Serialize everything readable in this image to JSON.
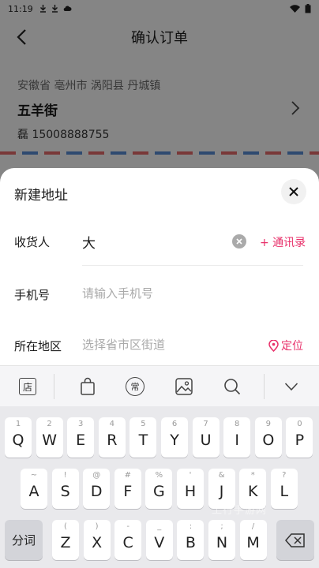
{
  "status_bar": {
    "time": "11:19"
  },
  "header": {
    "title": "确认订单"
  },
  "address": {
    "region": "安徽省 亳州市 涡阳县 丹城镇",
    "street": "五羊街",
    "contact": "磊 15008888755"
  },
  "sheet": {
    "title": "新建地址",
    "receiver": {
      "label": "收货人",
      "value": "大",
      "contacts_label": "+ 通讯录"
    },
    "phone": {
      "label": "手机号",
      "placeholder": "请输入手机号"
    },
    "region": {
      "label": "所在地区",
      "placeholder": "选择省市区街道",
      "locate_label": "定位"
    }
  },
  "keyboard": {
    "toolbar": {
      "shop_icon_text": "店",
      "common_icon_text": "常"
    },
    "row1": [
      {
        "hint": "1",
        "key": "Q"
      },
      {
        "hint": "2",
        "key": "W"
      },
      {
        "hint": "3",
        "key": "E"
      },
      {
        "hint": "4",
        "key": "R"
      },
      {
        "hint": "5",
        "key": "T"
      },
      {
        "hint": "6",
        "key": "Y"
      },
      {
        "hint": "7",
        "key": "U"
      },
      {
        "hint": "8",
        "key": "I"
      },
      {
        "hint": "9",
        "key": "O"
      },
      {
        "hint": "0",
        "key": "P"
      }
    ],
    "row2": [
      {
        "hint": "~",
        "key": "A"
      },
      {
        "hint": "!",
        "key": "S"
      },
      {
        "hint": "@",
        "key": "D"
      },
      {
        "hint": "#",
        "key": "F"
      },
      {
        "hint": "%",
        "key": "G"
      },
      {
        "hint": "'",
        "key": "H"
      },
      {
        "hint": "&",
        "key": "J"
      },
      {
        "hint": "*",
        "key": "K"
      },
      {
        "hint": "?",
        "key": "L"
      }
    ],
    "row3": [
      {
        "hint": "(",
        "key": "Z"
      },
      {
        "hint": ")",
        "key": "X"
      },
      {
        "hint": "-",
        "key": "C"
      },
      {
        "hint": "_",
        "key": "V"
      },
      {
        "hint": ":",
        "key": "B"
      },
      {
        "hint": ";",
        "key": "N"
      },
      {
        "hint": "/",
        "key": "M"
      }
    ],
    "segment_label": "分词"
  },
  "watermark": "工行手游网"
}
